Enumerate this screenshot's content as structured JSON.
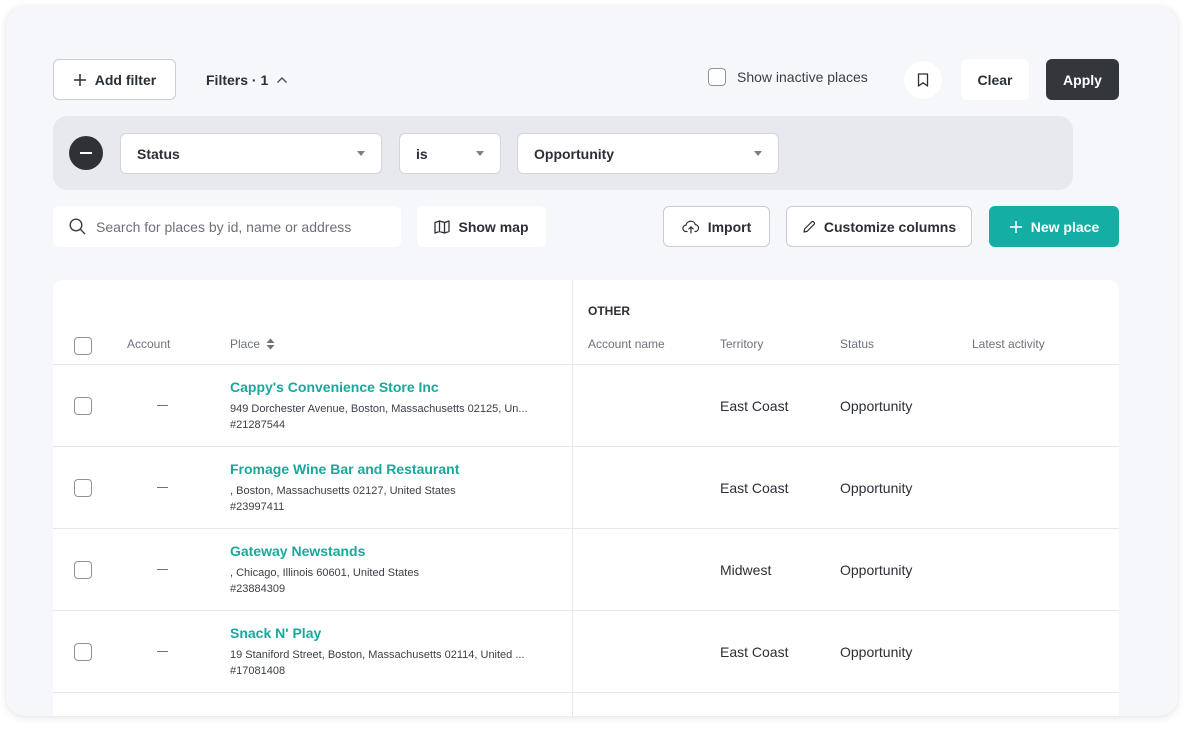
{
  "toolbar": {
    "add_filter_label": "Add filter",
    "filters_label": "Filters · 1",
    "show_inactive_label": "Show inactive places",
    "clear_label": "Clear",
    "apply_label": "Apply"
  },
  "filter": {
    "field": "Status",
    "operator": "is",
    "value": "Opportunity"
  },
  "search": {
    "placeholder": "Search for places by id, name or address"
  },
  "actions": {
    "show_map_label": "Show map",
    "import_label": "Import",
    "customize_label": "Customize columns",
    "new_place_label": "New place"
  },
  "table": {
    "group_header": "OTHER",
    "columns": {
      "account": "Account",
      "place": "Place",
      "account_name": "Account name",
      "territory": "Territory",
      "status": "Status",
      "latest_activity": "Latest activity"
    },
    "rows": [
      {
        "name": "Cappy's Convenience Store Inc",
        "address": "949 Dorchester Avenue, Boston, Massachusetts 02125, Un...",
        "id": "#21287544",
        "territory": "East Coast",
        "status": "Opportunity"
      },
      {
        "name": "Fromage Wine Bar and Restaurant",
        "address": ", Boston, Massachusetts 02127, United States",
        "id": "#23997411",
        "territory": "East Coast",
        "status": "Opportunity"
      },
      {
        "name": "Gateway Newstands",
        "address": ", Chicago, Illinois 60601, United States",
        "id": "#23884309",
        "territory": "Midwest",
        "status": "Opportunity"
      },
      {
        "name": "Snack N' Play",
        "address": "19 Staniford Street, Boston, Massachusetts 02114, United ...",
        "id": "#17081408",
        "territory": "East Coast",
        "status": "Opportunity"
      }
    ]
  },
  "colors": {
    "accent": "#14aea4",
    "link": "#1aa79c",
    "apply_bg": "#33363b"
  }
}
